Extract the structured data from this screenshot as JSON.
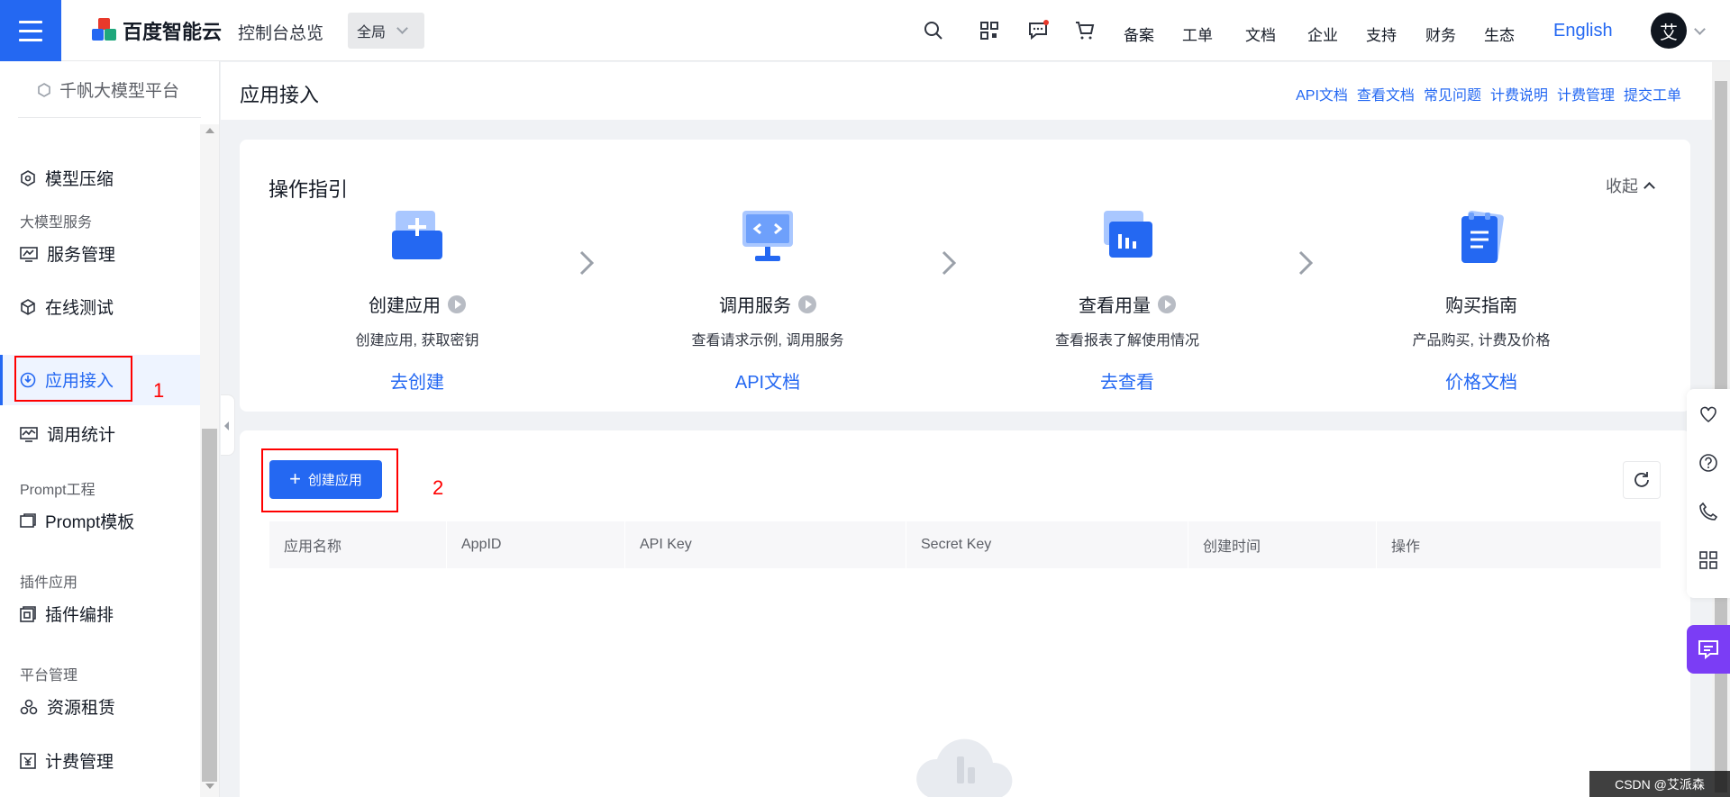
{
  "topbar": {
    "logo_text": "百度智能云",
    "console_overview": "控制台总览",
    "scope": "全局",
    "nav": [
      "备案",
      "工单",
      "文档",
      "企业",
      "支持",
      "财务",
      "生态"
    ],
    "language": "English",
    "avatar": "艾"
  },
  "sidebar": {
    "platform": "千帆大模型平台",
    "items": [
      {
        "label": "模型压缩",
        "icon": "model-compress-icon"
      },
      {
        "group": "大模型服务"
      },
      {
        "label": "服务管理",
        "icon": "service-manage-icon"
      },
      {
        "label": "在线测试",
        "icon": "online-test-icon"
      },
      {
        "label": "应用接入",
        "icon": "app-access-icon",
        "active": true
      },
      {
        "label": "调用统计",
        "icon": "call-stats-icon"
      },
      {
        "group": "Prompt工程"
      },
      {
        "label": "Prompt模板",
        "icon": "prompt-template-icon"
      },
      {
        "group": "插件应用"
      },
      {
        "label": "插件编排",
        "icon": "plugin-icon"
      },
      {
        "group": "平台管理"
      },
      {
        "label": "资源租赁",
        "icon": "resource-icon"
      },
      {
        "label": "计费管理",
        "icon": "billing-icon"
      }
    ]
  },
  "annotations": {
    "label1": "1",
    "label2": "2"
  },
  "page": {
    "title": "应用接入",
    "header_links": [
      "API文档",
      "查看文档",
      "常见问题",
      "计费说明",
      "计费管理",
      "提交工单"
    ]
  },
  "guide": {
    "title": "操作指引",
    "collapse": "收起",
    "steps": [
      {
        "name": "创建应用",
        "desc": "创建应用, 获取密钥",
        "link": "去创建",
        "has_video": true
      },
      {
        "name": "调用服务",
        "desc": "查看请求示例, 调用服务",
        "link": "API文档",
        "has_video": true
      },
      {
        "name": "查看用量",
        "desc": "查看报表了解使用情况",
        "link": "去查看",
        "has_video": true
      },
      {
        "name": "购买指南",
        "desc": "产品购买, 计费及价格",
        "link": "价格文档",
        "has_video": false
      }
    ]
  },
  "table": {
    "create_button": "创建应用",
    "columns": [
      "应用名称",
      "AppID",
      "API Key",
      "Secret Key",
      "创建时间",
      "操作"
    ]
  },
  "watermark": {
    "text": "CSDN @艾派森"
  },
  "colors": {
    "primary": "#2468f2",
    "chat": "#7b3df5",
    "annotation": "#ff0000"
  }
}
